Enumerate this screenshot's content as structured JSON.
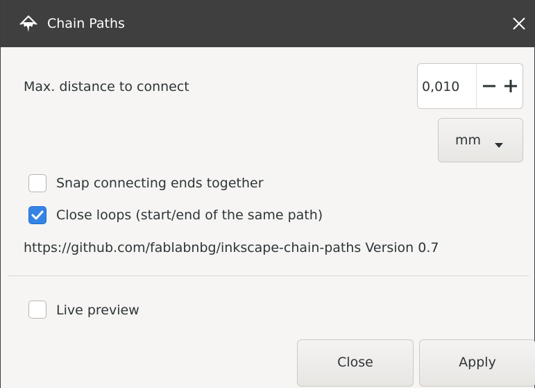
{
  "window": {
    "title": "Chain Paths"
  },
  "form": {
    "distance_label": "Max. distance to connect",
    "distance_value": "0,010",
    "unit_value": "mm",
    "snap_label": "Snap connecting ends together",
    "snap_checked": false,
    "close_loops_label": "Close loops (start/end of the same path)",
    "close_loops_checked": true,
    "info_text": "https://github.com/fablabnbg/inkscape-chain-paths Version 0.7",
    "live_preview_label": "Live preview",
    "live_preview_checked": false
  },
  "buttons": {
    "close_label": "Close",
    "apply_label": "Apply"
  },
  "icons": {
    "app": "inkscape-logo-icon",
    "close": "close-icon",
    "minus": "minus-icon",
    "plus": "plus-icon",
    "dropdown": "chevron-down-icon",
    "check": "checkmark-icon"
  },
  "colors": {
    "titlebar": "#3f3f3f",
    "accent": "#3584e4",
    "background": "#f6f5f4"
  }
}
